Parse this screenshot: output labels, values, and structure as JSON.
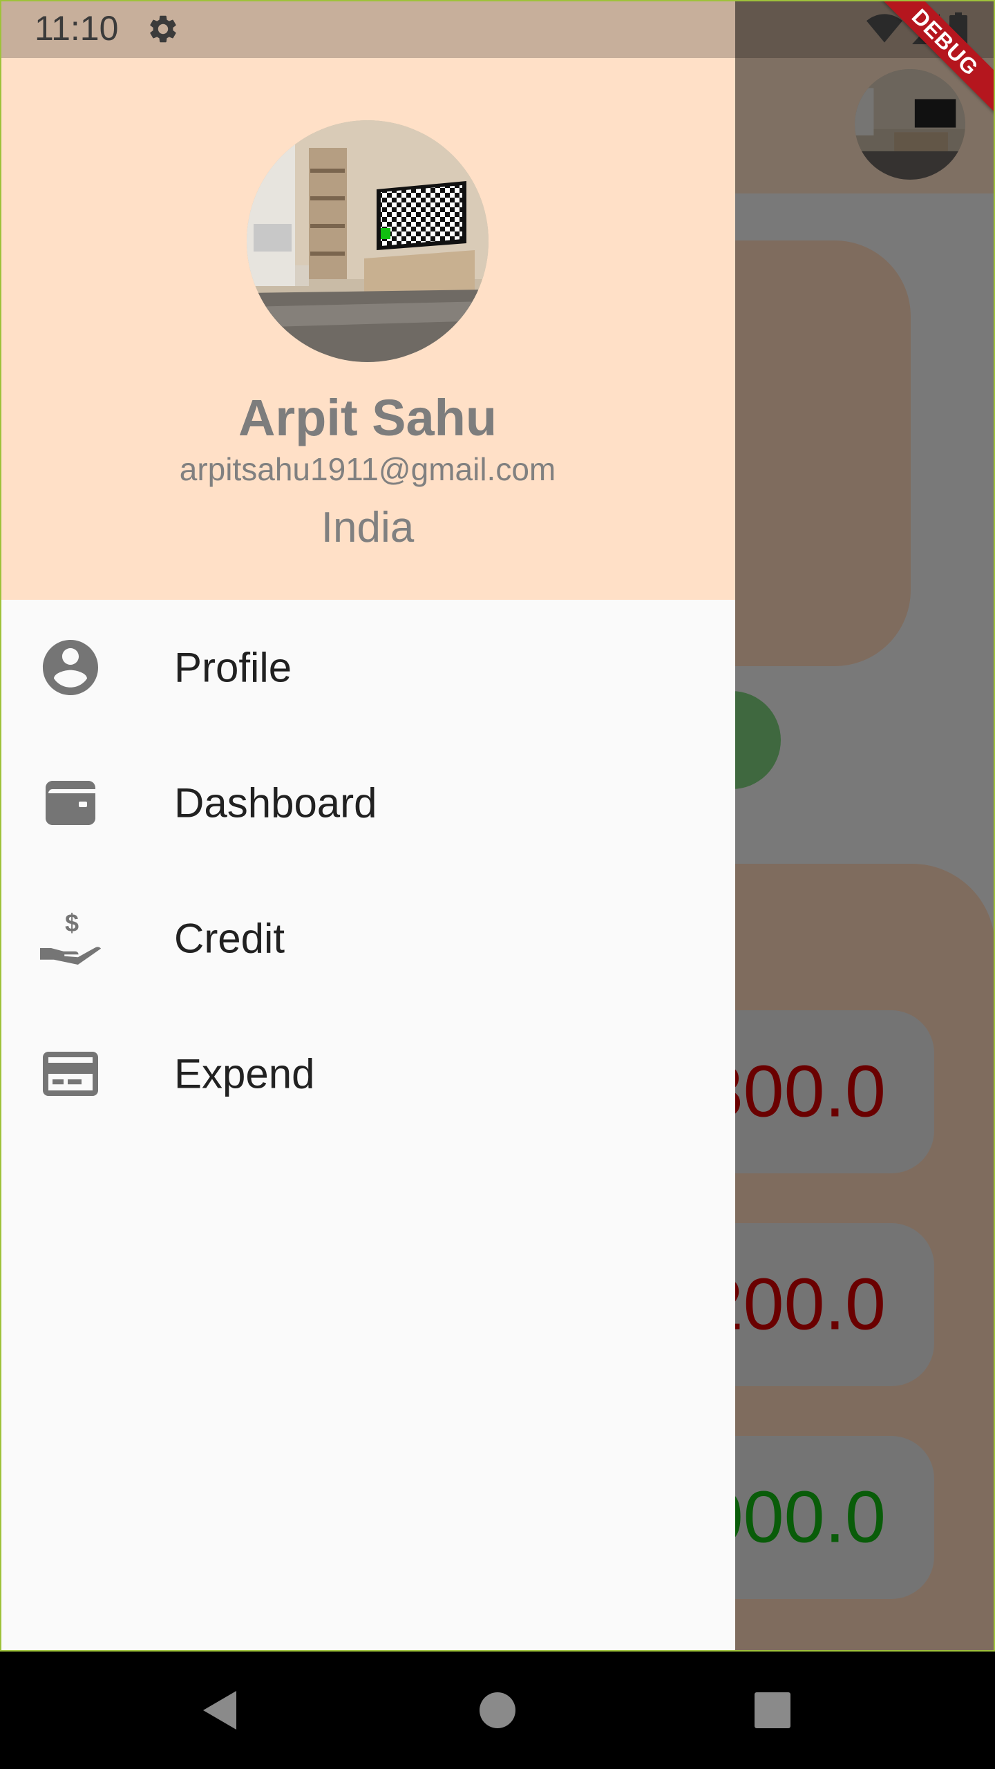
{
  "status_bar": {
    "time": "11:10"
  },
  "debug_banner": "DEBUG",
  "drawer": {
    "user": {
      "name": "Arpit Sahu",
      "email": "arpitsahu1911@gmail.com",
      "country": "India"
    },
    "menu": [
      {
        "label": "Profile",
        "icon": "account-circle-icon"
      },
      {
        "label": "Dashboard",
        "icon": "wallet-icon"
      },
      {
        "label": "Credit",
        "icon": "hand-dollar-icon"
      },
      {
        "label": "Expend",
        "icon": "credit-card-icon"
      }
    ]
  },
  "background": {
    "amounts": [
      {
        "text": "300.0",
        "color": "#d40000"
      },
      {
        "text": "200.0",
        "color": "#d40000"
      },
      {
        "text": "000.0",
        "color": "#12b812"
      }
    ]
  },
  "colors": {
    "header_bg": "#ffe0c7",
    "drawer_bg": "#fafafa",
    "accent_red": "#d40000",
    "accent_green": "#12b812"
  }
}
